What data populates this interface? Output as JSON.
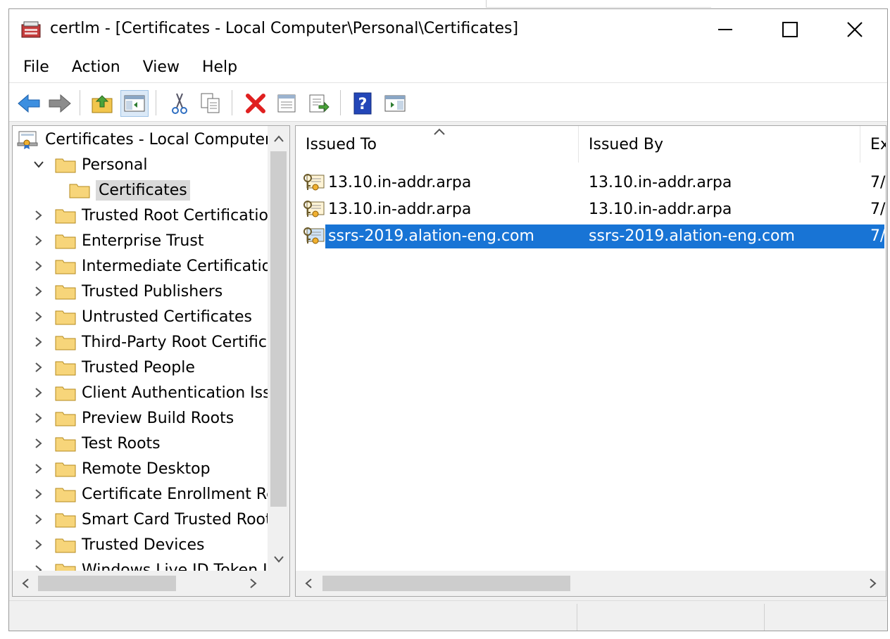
{
  "window": {
    "title": "certlm - [Certificates - Local Computer\\Personal\\Certificates]"
  },
  "menu": [
    "File",
    "Action",
    "View",
    "Help"
  ],
  "toolbar": {
    "icons": [
      "back-arrow-icon",
      "forward-arrow-icon",
      "up-folder-icon",
      "show-hide-console-tree-icon",
      "cut-icon",
      "copy-icon",
      "delete-icon",
      "properties-icon",
      "export-list-icon",
      "help-icon",
      "show-hide-action-pane-icon"
    ]
  },
  "tree": {
    "root": "Certificates - Local Computer",
    "items": [
      {
        "label": "Personal",
        "expanded": true
      },
      {
        "label": "Certificates",
        "selected": true,
        "child": true
      },
      {
        "label": "Trusted Root Certification"
      },
      {
        "label": "Enterprise Trust"
      },
      {
        "label": "Intermediate Certification"
      },
      {
        "label": "Trusted Publishers"
      },
      {
        "label": "Untrusted Certificates"
      },
      {
        "label": "Third-Party Root Certificat"
      },
      {
        "label": "Trusted People"
      },
      {
        "label": "Client Authentication Issu"
      },
      {
        "label": "Preview Build Roots"
      },
      {
        "label": "Test Roots"
      },
      {
        "label": "Remote Desktop"
      },
      {
        "label": "Certificate Enrollment Rec"
      },
      {
        "label": "Smart Card Trusted Roots"
      },
      {
        "label": "Trusted Devices"
      },
      {
        "label": "Windows Live ID Token Iss"
      }
    ]
  },
  "list": {
    "columns": [
      "Issued To",
      "Issued By",
      "Ex"
    ],
    "rows": [
      {
        "issued_to": "13.10.in-addr.arpa",
        "issued_by": "13.10.in-addr.arpa",
        "expiry": "7/",
        "selected": false
      },
      {
        "issued_to": "13.10.in-addr.arpa",
        "issued_by": "13.10.in-addr.arpa",
        "expiry": "7/",
        "selected": false
      },
      {
        "issued_to": "ssrs-2019.alation-eng.com",
        "issued_by": "ssrs-2019.alation-eng.com",
        "expiry": "7/",
        "selected": true
      }
    ]
  },
  "colors": {
    "selection": "#1874d5",
    "tree_selection": "#d9d9d9",
    "folder": "#f7d57a",
    "delete_red": "#e02020"
  }
}
